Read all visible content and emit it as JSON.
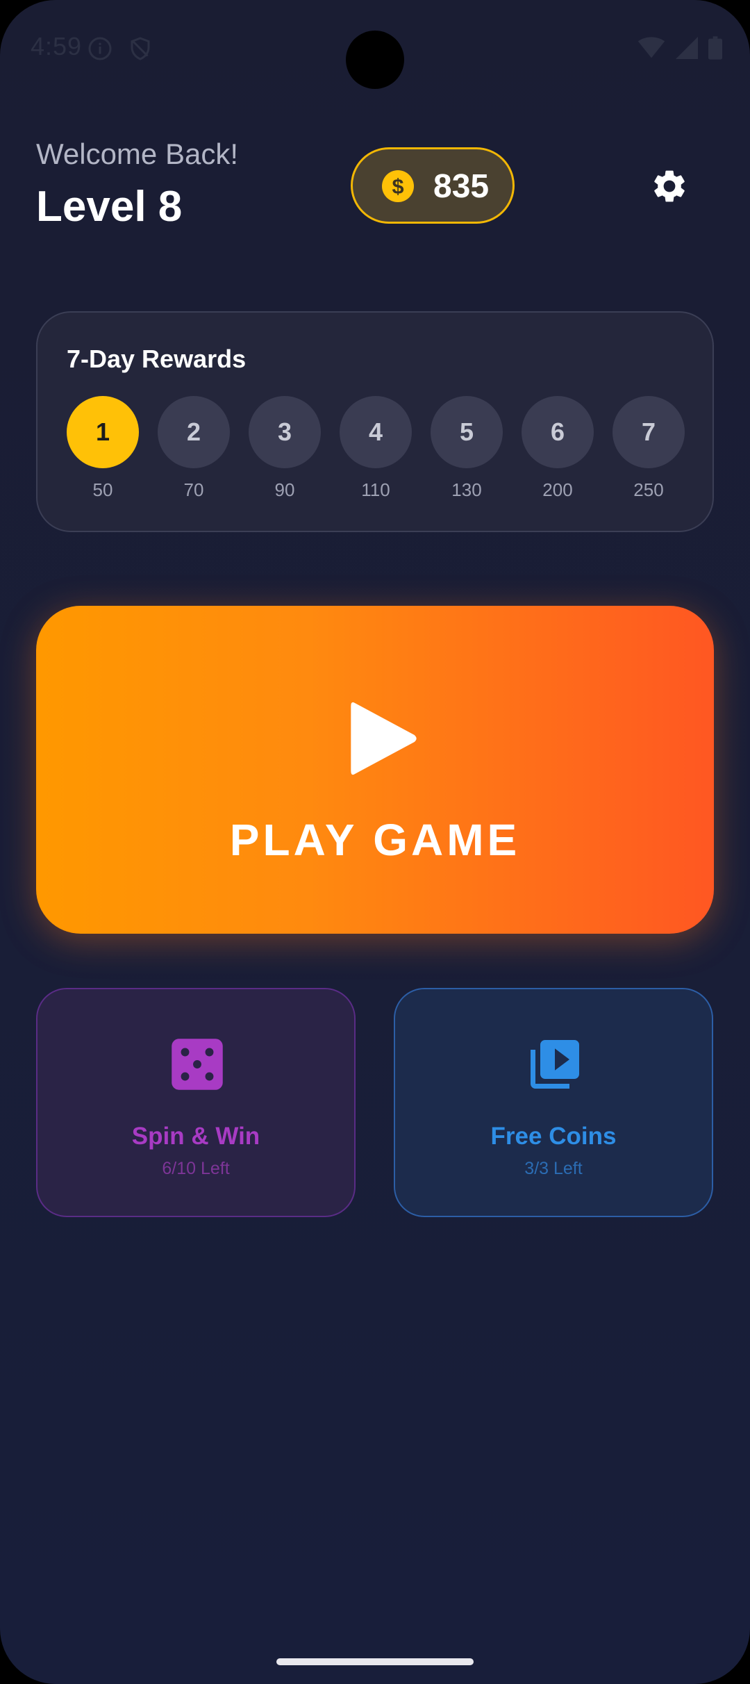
{
  "status_bar": {
    "time": "4:59",
    "icons": [
      "info-icon",
      "shield-icon",
      "wifi-icon",
      "signal-icon",
      "battery-icon"
    ]
  },
  "header": {
    "greeting": "Welcome Back!",
    "level": "Level 8",
    "coins": "835",
    "settings_icon": "gear-icon"
  },
  "rewards": {
    "title": "7-Day Rewards",
    "days": [
      {
        "day": "1",
        "coins": "50",
        "active": true
      },
      {
        "day": "2",
        "coins": "70",
        "active": false
      },
      {
        "day": "3",
        "coins": "90",
        "active": false
      },
      {
        "day": "4",
        "coins": "110",
        "active": false
      },
      {
        "day": "5",
        "coins": "130",
        "active": false
      },
      {
        "day": "6",
        "coins": "200",
        "active": false
      },
      {
        "day": "7",
        "coins": "250",
        "active": false
      }
    ]
  },
  "play": {
    "label": "PLAY GAME",
    "icon": "play-icon"
  },
  "tiles": {
    "spin": {
      "title": "Spin & Win",
      "subtitle": "6/10 Left",
      "icon": "dice-icon"
    },
    "free": {
      "title": "Free Coins",
      "subtitle": "3/3 Left",
      "icon": "video-library-icon"
    }
  },
  "colors": {
    "background": "#1a1d33",
    "accent_gold": "#ffc107",
    "play_start": "#ff9800",
    "play_end": "#ff5722",
    "spin_purple": "#a83bc4",
    "free_blue": "#2e8ee6"
  }
}
